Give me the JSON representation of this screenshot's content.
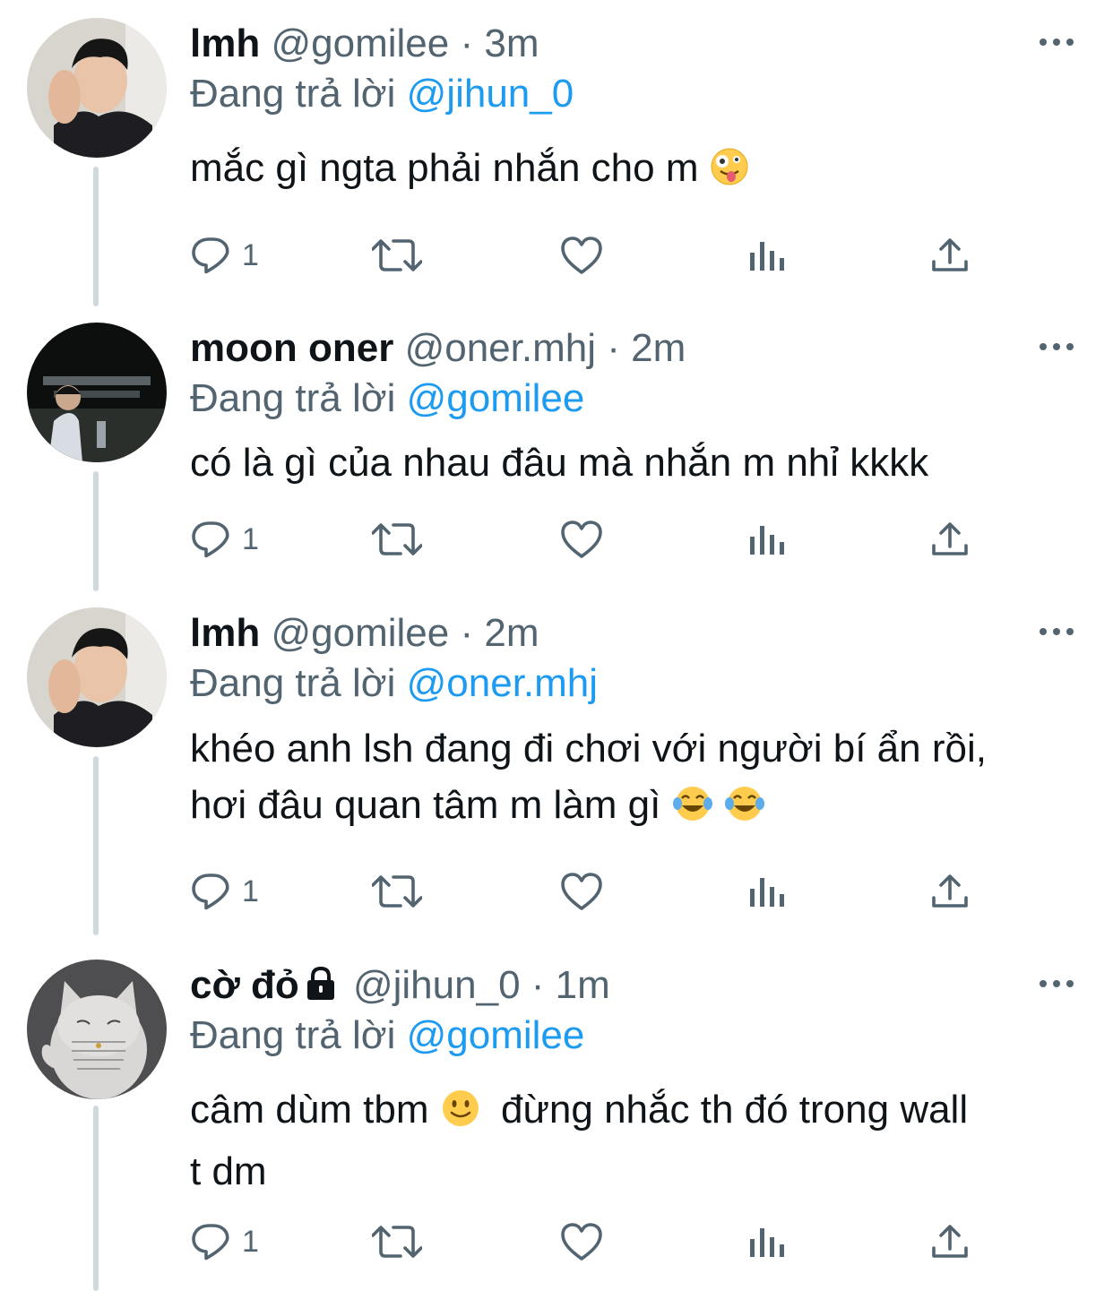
{
  "reply_prefix": "Đang trả lời",
  "tweets": [
    {
      "name": "lmh",
      "handle": "@gomilee",
      "sep": "·",
      "time": "3m",
      "reply_to": "@jihun_0",
      "text_lines": [
        "mắc gì ngta phải nhắn cho m"
      ],
      "emoji": "zany-face",
      "reply_count": "1"
    },
    {
      "name": "moon oner",
      "handle": "@oner.mhj",
      "sep": "·",
      "time": "2m",
      "reply_to": "@gomilee",
      "text_lines": [
        "có là gì của nhau đâu mà nhắn m nhỉ kkkk"
      ],
      "reply_count": "1"
    },
    {
      "name": "lmh",
      "handle": "@gomilee",
      "sep": "·",
      "time": "2m",
      "reply_to": "@oner.mhj",
      "text_lines": [
        "khéo anh lsh đang đi chơi với người bí ẩn rồi,",
        "hơi đâu quan tâm m làm gì"
      ],
      "emoji": "tears-of-joy-face",
      "reply_count": "1"
    },
    {
      "name": "cờ đỏ",
      "protected": true,
      "handle": "@jihun_0",
      "sep": "·",
      "time": "1m",
      "reply_to": "@gomilee",
      "text_part1": "câm dùm tbm",
      "text_part2": "đừng nhắc th đó trong wall",
      "text_line2": "t dm",
      "emoji": "slightly-smiling-face",
      "reply_count": "1"
    }
  ],
  "colors": {
    "accent": "#1d9bf0",
    "muted": "#536471",
    "line": "#cfd9de",
    "text": "#0f1419"
  }
}
